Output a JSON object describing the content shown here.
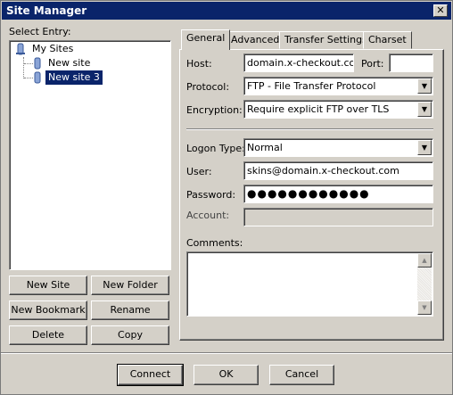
{
  "window": {
    "title": "Site Manager",
    "close": "✕"
  },
  "left": {
    "select_label": "Select Entry:",
    "tree": {
      "root": "My Sites",
      "items": [
        "New site",
        "New site 3"
      ],
      "selected_index": 1
    },
    "buttons": {
      "new_site": "New Site",
      "new_folder": "New Folder",
      "new_bookmark": "New Bookmark",
      "rename": "Rename",
      "delete": "Delete",
      "copy": "Copy"
    }
  },
  "tabs": [
    "General",
    "Advanced",
    "Transfer Settings",
    "Charset"
  ],
  "general": {
    "host_label": "Host:",
    "host_value": "domain.x-checkout.com",
    "port_label": "Port:",
    "port_value": "",
    "protocol_label": "Protocol:",
    "protocol_value": "FTP - File Transfer Protocol",
    "encryption_label": "Encryption:",
    "encryption_value": "Require explicit FTP over TLS",
    "logon_label": "Logon Type:",
    "logon_value": "Normal",
    "user_label": "User:",
    "user_value": "skins@domain.x-checkout.com",
    "password_label": "Password:",
    "password_value": "●●●●●●●●●●●●",
    "account_label": "Account:",
    "account_value": "",
    "comments_label": "Comments:",
    "comments_value": ""
  },
  "footer": {
    "connect": "Connect",
    "ok": "OK",
    "cancel": "Cancel"
  }
}
